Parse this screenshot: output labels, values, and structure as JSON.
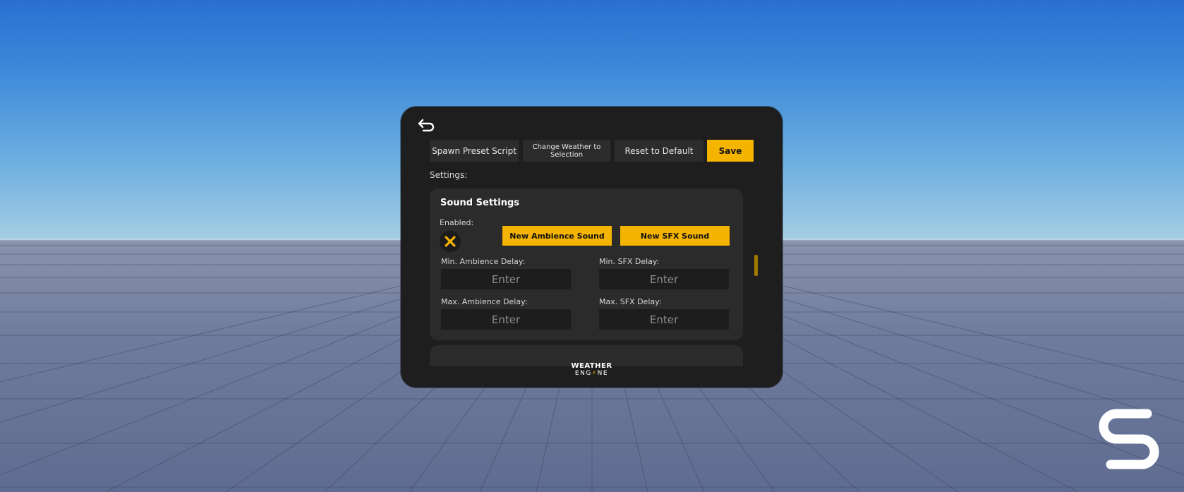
{
  "panel": {
    "toolbar": {
      "spawn_preset": "Spawn Preset Script",
      "change_weather": "Change Weather to Selection",
      "reset_default": "Reset to Default",
      "save": "Save"
    },
    "settings_label": "Settings:",
    "sound_settings": {
      "title": "Sound Settings",
      "enabled_label": "Enabled:",
      "enabled": false,
      "new_ambience_button": "New Ambience Sound",
      "new_sfx_button": "New SFX Sound",
      "min_ambience_label": "Min. Ambience Delay:",
      "min_sfx_label": "Min. SFX Delay:",
      "max_ambience_label": "Max. Ambience Delay:",
      "max_sfx_label": "Max. SFX Delay:",
      "input_placeholder": "Enter"
    },
    "logo": {
      "line1": "WEATHER",
      "line2_pre": "ENG",
      "line2_bolt": "⚡",
      "line2_post": "NE"
    }
  },
  "colors": {
    "accent": "#f5b400",
    "panel_bg": "#1e1e1e",
    "card_bg": "#2b2b2b",
    "input_bg": "#1d1d1d"
  },
  "icons": {
    "back": "back-arrow-icon",
    "toggle": "close-x-icon",
    "corner": "s-logo-icon"
  }
}
